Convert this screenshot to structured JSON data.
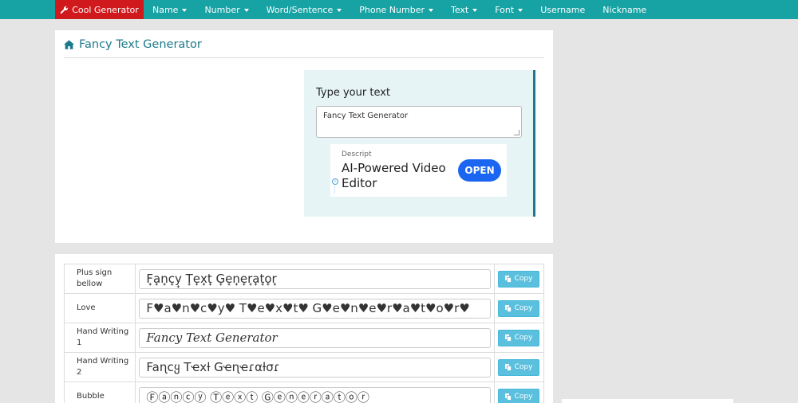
{
  "nav": {
    "brand_label": "Cool Generator",
    "brand_color": "#d0191d",
    "bar_color": "#17a2a4",
    "items": [
      {
        "label": "Name",
        "dropdown": true
      },
      {
        "label": "Number",
        "dropdown": true
      },
      {
        "label": "Word/Sentence",
        "dropdown": true
      },
      {
        "label": "Phone Number",
        "dropdown": true
      },
      {
        "label": "Text",
        "dropdown": true
      },
      {
        "label": "Font",
        "dropdown": true
      },
      {
        "label": "Username",
        "dropdown": false
      },
      {
        "label": "Nickname",
        "dropdown": false
      }
    ]
  },
  "page": {
    "title": "Fancy Text Generator",
    "title_icon": "home-icon"
  },
  "input": {
    "label": "Type your text",
    "value": "Fancy Text Generator"
  },
  "ad": {
    "sponsor": "Descript",
    "headline": "AI-Powered Video Editor",
    "cta": "OPEN"
  },
  "results": {
    "copy_label": "Copy",
    "rows": [
      {
        "name": "Plus sign bellow",
        "output": "F̟a̟n̟c̟y̟ T̟e̟x̟t̟ G̟e̟n̟e̟r̟a̟t̟o̟r̟",
        "style": "plus"
      },
      {
        "name": "Love",
        "output": "F♥a♥n♥c♥y♥ T♥e♥x♥t♥ G♥e♥n♥e♥r♥a♥t♥o♥r♥",
        "style": "love"
      },
      {
        "name": "Hand Writing 1",
        "output": "Fancy Text Generator",
        "style": "hw1"
      },
      {
        "name": "Hand Writing 2",
        "output": "Faɳcყ Tҽxƚ Gҽɳҽɾαƚσɾ",
        "style": "hw2"
      },
      {
        "name": "Bubble",
        "output": "Ⓕⓐⓝⓒⓨ Ⓣⓔⓧⓣ Ⓖⓔⓝⓔⓡⓐⓣⓞⓡ",
        "style": "bubble"
      }
    ]
  }
}
